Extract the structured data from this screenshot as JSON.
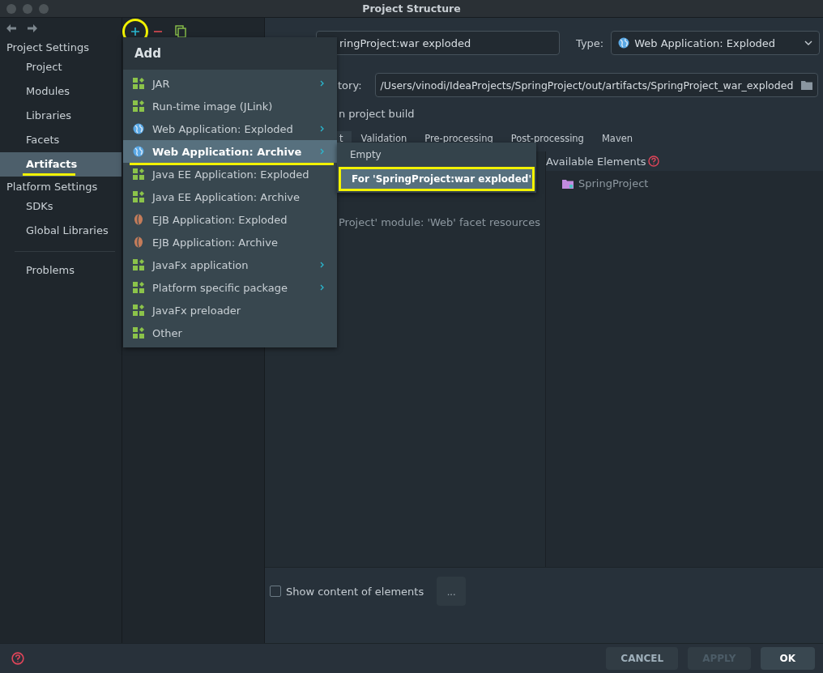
{
  "window": {
    "title": "Project Structure"
  },
  "sidebar": {
    "sections": [
      {
        "title": "Project Settings",
        "items": [
          {
            "label": "Project",
            "selected": false,
            "highlighted": false
          },
          {
            "label": "Modules",
            "selected": false,
            "highlighted": false
          },
          {
            "label": "Libraries",
            "selected": false,
            "highlighted": false
          },
          {
            "label": "Facets",
            "selected": false,
            "highlighted": false
          },
          {
            "label": "Artifacts",
            "selected": true,
            "highlighted": true
          }
        ]
      },
      {
        "title": "Platform Settings",
        "items": [
          {
            "label": "SDKs",
            "selected": false,
            "highlighted": false
          },
          {
            "label": "Global Libraries",
            "selected": false,
            "highlighted": false
          }
        ]
      }
    ],
    "footer_items": [
      {
        "label": "Problems",
        "selected": false
      }
    ]
  },
  "toolbar": {
    "add_highlighted": true
  },
  "add_menu": {
    "title": "Add",
    "items": [
      {
        "label": "JAR",
        "kind": "module",
        "submenu": true,
        "selected": false,
        "highlighted": false
      },
      {
        "label": "Run-time image (JLink)",
        "kind": "module",
        "submenu": false,
        "selected": false,
        "highlighted": false
      },
      {
        "label": "Web Application: Exploded",
        "kind": "globe",
        "submenu": true,
        "selected": false,
        "highlighted": false
      },
      {
        "label": "Web Application: Archive",
        "kind": "globe",
        "submenu": true,
        "selected": true,
        "highlighted": true
      },
      {
        "label": "Java EE Application: Exploded",
        "kind": "module",
        "submenu": false,
        "selected": false,
        "highlighted": false
      },
      {
        "label": "Java EE Application: Archive",
        "kind": "module",
        "submenu": false,
        "selected": false,
        "highlighted": false
      },
      {
        "label": "EJB Application: Exploded",
        "kind": "bean",
        "submenu": false,
        "selected": false,
        "highlighted": false
      },
      {
        "label": "EJB Application: Archive",
        "kind": "bean",
        "submenu": false,
        "selected": false,
        "highlighted": false
      },
      {
        "label": "JavaFx application",
        "kind": "module",
        "submenu": true,
        "selected": false,
        "highlighted": false
      },
      {
        "label": "Platform specific package",
        "kind": "module",
        "submenu": true,
        "selected": false,
        "highlighted": false
      },
      {
        "label": "JavaFx preloader",
        "kind": "module",
        "submenu": false,
        "selected": false,
        "highlighted": false
      },
      {
        "label": "Other",
        "kind": "module",
        "submenu": false,
        "selected": false,
        "highlighted": false
      }
    ]
  },
  "submenu": {
    "items": [
      {
        "label": "Empty",
        "selected": false,
        "highlighted": false
      },
      {
        "label": "For 'SpringProject:war exploded'",
        "selected": true,
        "highlighted": true
      }
    ]
  },
  "artifact": {
    "name": "ringProject:war exploded",
    "type_label": "Type:",
    "type": "Web Application: Exploded",
    "directory_label": "tory:",
    "directory": "/Users/vinodi/IdeaProjects/SpringProject/out/artifacts/SpringProject_war_exploded",
    "build_label": "n project build",
    "tabs": [
      {
        "label": "t",
        "selected": true
      },
      {
        "label": "Validation",
        "selected": false
      },
      {
        "label": "Pre-processing",
        "selected": false
      },
      {
        "label": "Post-processing",
        "selected": false
      },
      {
        "label": "Maven",
        "selected": false
      }
    ],
    "output_items": [
      "Project' module: 'Web' facet resources"
    ],
    "available_title": "Available Elements",
    "available_items": [
      "SpringProject"
    ],
    "show_content": {
      "label": "Show content of elements",
      "checked": false
    },
    "more_button": "..."
  },
  "buttons": [
    {
      "label": "CANCEL",
      "disabled": false,
      "default": false
    },
    {
      "label": "APPLY",
      "disabled": true,
      "default": false
    },
    {
      "label": "OK",
      "disabled": false,
      "default": true
    }
  ]
}
